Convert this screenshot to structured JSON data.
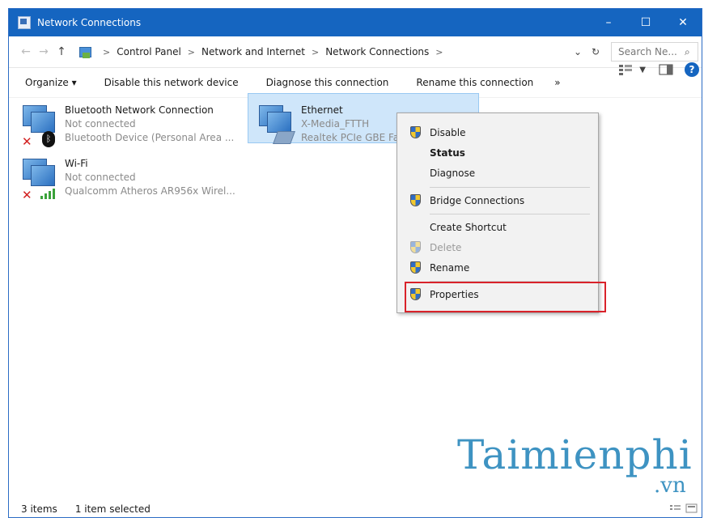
{
  "window": {
    "title": "Network Connections"
  },
  "controls": {
    "minimize": "–",
    "maximize": "☐",
    "close": "✕"
  },
  "address": {
    "back": "←",
    "forward": "→",
    "up": "↑",
    "sep": ">",
    "crumbs": [
      "Control Panel",
      "Network and Internet",
      "Network Connections"
    ],
    "dropdown": "⌄",
    "refresh": "↻",
    "search_placeholder": "Search Ne...",
    "search_icon": "⌕"
  },
  "toolbar": {
    "organize": "Organize ▾",
    "disable": "Disable this network device",
    "diagnose": "Diagnose this connection",
    "rename": "Rename this connection",
    "more": "»",
    "help": "?"
  },
  "connections": [
    {
      "name": "Bluetooth Network Connection",
      "status": "Not connected",
      "device": "Bluetooth Device (Personal Area ..."
    },
    {
      "name": "Ethernet",
      "status": "X-Media_FTTH",
      "device": "Realtek PCIe GBE Fa"
    },
    {
      "name": "Wi-Fi",
      "status": "Not connected",
      "device": "Qualcomm Atheros AR956x Wirel..."
    }
  ],
  "icons": {
    "red_x": "✕",
    "bluetooth": "ᛒ"
  },
  "context_menu": {
    "items": [
      {
        "label": "Disable",
        "shield": true
      },
      {
        "label": "Status",
        "shield": false
      },
      {
        "label": "Diagnose",
        "shield": false
      },
      {
        "label": "Bridge Connections",
        "shield": true
      },
      {
        "label": "Create Shortcut",
        "shield": false
      },
      {
        "label": "Delete",
        "shield": true
      },
      {
        "label": "Rename",
        "shield": true
      },
      {
        "label": "Properties",
        "shield": true
      }
    ]
  },
  "watermark": {
    "main": "Taimienphi",
    "suffix": ".vn"
  },
  "status": {
    "items": "3 items",
    "selected": "1 item selected"
  },
  "colors": {
    "titlebar": "#1565c0",
    "selection": "#cfe6fa",
    "highlight": "#d9222a",
    "watermark": "#3e93c2"
  }
}
